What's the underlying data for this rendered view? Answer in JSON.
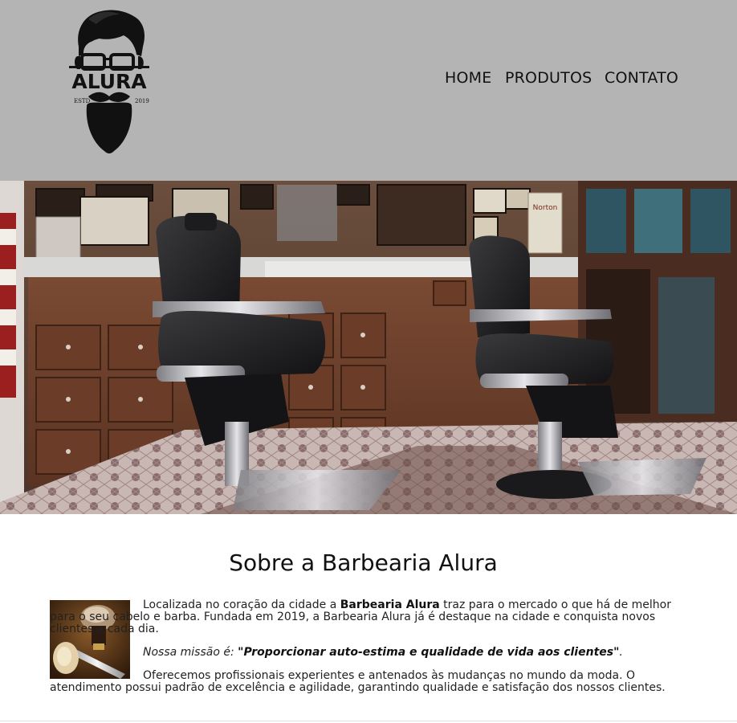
{
  "logo": {
    "brand": "ALURA",
    "est_left": "ESTD",
    "est_right": "2019"
  },
  "nav": {
    "items": [
      {
        "label": "HOME"
      },
      {
        "label": "PRODUTOS"
      },
      {
        "label": "CONTATO"
      }
    ]
  },
  "banner": {
    "poster_text": "Norton"
  },
  "about": {
    "title": "Sobre a Barbearia Alura",
    "p1_before": "Localizada no coração da cidade a ",
    "p1_strong": "Barbearia Alura",
    "p1_after": " traz para o mercado o que há de melhor para o seu cabelo e barba. Fundada em 2019, a Barbearia Alura já é destaque na cidade e conquista novos clientes a cada dia.",
    "mission_label": "Nossa missão é: ",
    "mission_quote": "\"Proporcionar auto-estima e qualidade de vida aos clientes\"",
    "mission_end": ".",
    "p3": "Oferecemos profissionais experientes e antenados às mudanças no mundo da moda. O atendimento possui padrão de excelência e agilidade, garantindo qualidade e satisfação dos nossos clientes."
  },
  "colors": {
    "header_bg": "#b4b4b4",
    "text": "#111111"
  }
}
